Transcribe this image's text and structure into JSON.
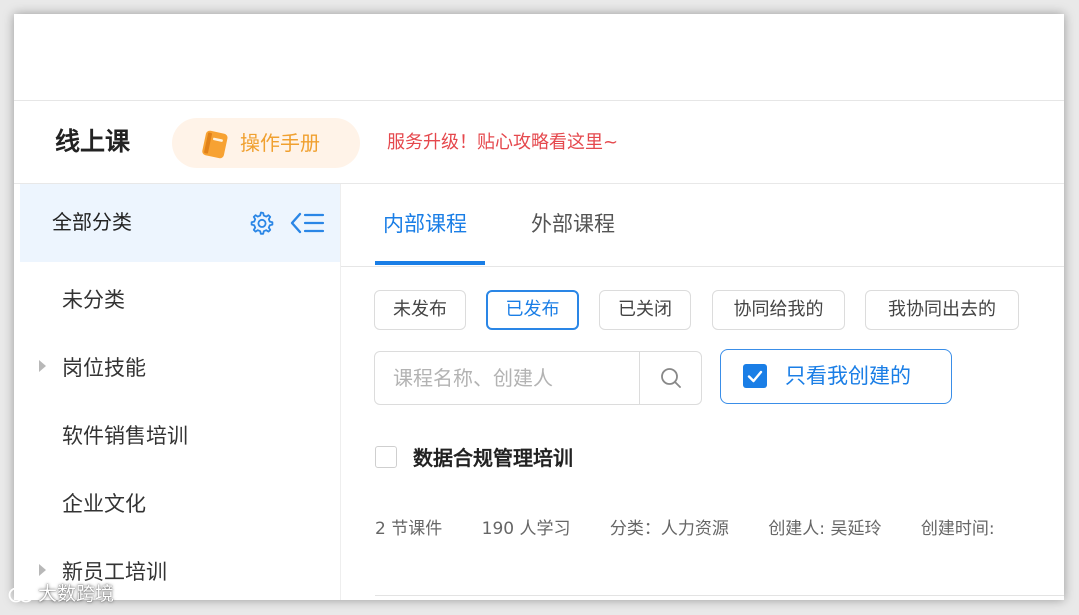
{
  "header": {
    "title": "线上课",
    "manual_button": "操作手册",
    "notice": "服务升级！贴心攻略看这里~"
  },
  "sidebar": {
    "title": "全部分类",
    "items": [
      {
        "label": "未分类",
        "expandable": false
      },
      {
        "label": "岗位技能",
        "expandable": true
      },
      {
        "label": "软件销售培训",
        "expandable": false
      },
      {
        "label": "企业文化",
        "expandable": false
      },
      {
        "label": "新员工培训",
        "expandable": true
      }
    ]
  },
  "tabs": [
    {
      "label": "内部课程",
      "active": true
    },
    {
      "label": "外部课程",
      "active": false
    }
  ],
  "filters": [
    {
      "label": "未发布",
      "active": false
    },
    {
      "label": "已发布",
      "active": true
    },
    {
      "label": "已关闭",
      "active": false
    },
    {
      "label": "协同给我的",
      "active": false
    },
    {
      "label": "我协同出去的",
      "active": false
    }
  ],
  "search": {
    "placeholder": "课程名称、创建人",
    "value": ""
  },
  "only_mine": {
    "label": "只看我创建的",
    "checked": true
  },
  "course": {
    "title": "数据合规管理培训",
    "lessons": "2 节课件",
    "learners": "190 人学习",
    "category": "分类：人力资源",
    "creator": "创建人: 吴延玲",
    "created_time": "创建时间:"
  },
  "watermark": "大数跨境",
  "colors": {
    "accent": "#1a7ee6",
    "notice": "#e5484d",
    "manual": "#f0a030",
    "sidebar_active_bg": "#edf5fe"
  }
}
